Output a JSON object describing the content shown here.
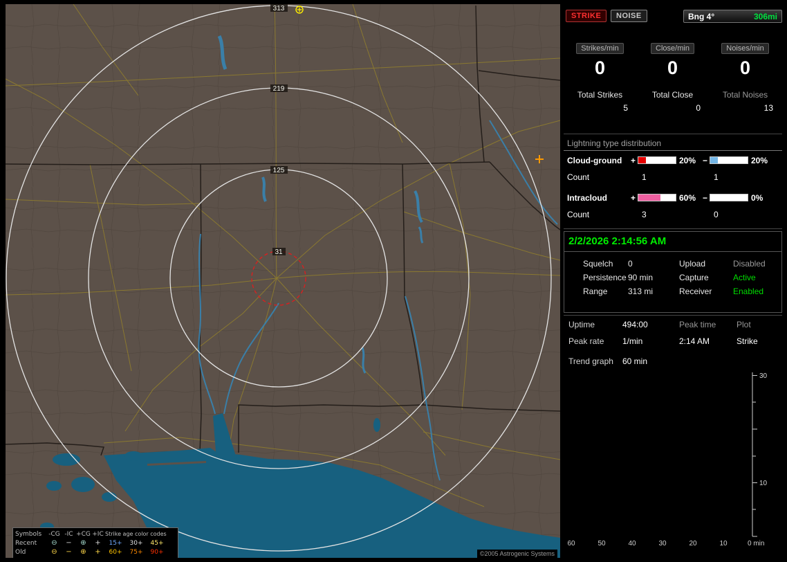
{
  "topbar": {
    "strike_button": "STRIKE",
    "noise_button": "NOISE",
    "bearing": "Bng 4°",
    "distance": "306mi"
  },
  "rates": [
    {
      "label": "Strikes/min",
      "value": "0"
    },
    {
      "label": "Close/min",
      "value": "0"
    },
    {
      "label": "Noises/min",
      "value": "0"
    }
  ],
  "totals": [
    {
      "label": "Total Strikes",
      "value": "5",
      "color": "#e8e8e8"
    },
    {
      "label": "Total Close",
      "value": "0",
      "color": "#e8e8e8"
    },
    {
      "label": "Total Noises",
      "value": "13",
      "color": "#9a9a9a"
    }
  ],
  "distribution": {
    "title": "Lightning type distribution",
    "plus_sign": "+",
    "minus_sign": "−",
    "count_label": "Count",
    "rows": [
      {
        "label": "Cloud-ground",
        "pos_fill": 20,
        "pos_color": "#e60000",
        "pos_pct": "20%",
        "neg_fill": 20,
        "neg_color": "#74b6e6",
        "neg_pct": "20%",
        "pos_count": "1",
        "neg_count": "1"
      },
      {
        "label": "Intracloud",
        "pos_fill": 60,
        "pos_color": "#ee5fa0",
        "pos_pct": "60%",
        "neg_fill": 0,
        "neg_color": "#74b6e6",
        "neg_pct": "0%",
        "pos_count": "3",
        "neg_count": "0"
      }
    ]
  },
  "status": {
    "datetime": "2/2/2026 2:14:56 AM",
    "rows": [
      {
        "l1": "Squelch",
        "v1": "0",
        "l2": "Upload",
        "v2": "Disabled",
        "v2_color": "#9a9a9a"
      },
      {
        "l1": "Persistence",
        "v1": "90 min",
        "l2": "Capture",
        "v2": "Active",
        "v2_color": "#00dd00"
      },
      {
        "l1": "Range",
        "v1": "313 mi",
        "l2": "Receiver",
        "v2": "Enabled",
        "v2_color": "#00dd00"
      }
    ]
  },
  "trend": {
    "uptime_label": "Uptime",
    "uptime_value": "494:00",
    "peak_time_label": "Peak time",
    "plot_label": "Plot",
    "peak_rate_label": "Peak rate",
    "peak_rate_value": "1/min",
    "peak_time_value": "2:14 AM",
    "plot_value": "Strike",
    "trend_graph_label": "Trend graph",
    "trend_graph_value": "60 min",
    "y_ticks": [
      "30",
      "10"
    ],
    "x_ticks": [
      "60",
      "50",
      "40",
      "30",
      "20",
      "10",
      "0 min"
    ]
  },
  "map": {
    "rings": [
      {
        "label": "313"
      },
      {
        "label": "219"
      },
      {
        "label": "125"
      },
      {
        "label": "31"
      }
    ],
    "copyright": "©2005 Astrogenic Systems",
    "legend": {
      "symbols_header": "Symbols",
      "age_header": "Strike age color codes",
      "columns": [
        "-CG",
        "-IC",
        "+CG",
        "+IC"
      ],
      "rows": [
        {
          "label": "Recent",
          "symbols": [
            {
              "glyph": "⊖",
              "color": "#a8ddd0"
            },
            {
              "glyph": "−",
              "color": "#d8d8d8"
            },
            {
              "glyph": "⊕",
              "color": "#a8ddd0"
            },
            {
              "glyph": "+",
              "color": "#d8d8d8"
            }
          ],
          "ages": [
            {
              "text": "15+",
              "color": "#6fa8ff"
            },
            {
              "text": "30+",
              "color": "#e0e0e0"
            },
            {
              "text": "45+",
              "color": "#ffe96a"
            }
          ]
        },
        {
          "label": "Old",
          "symbols": [
            {
              "glyph": "⊖",
              "color": "#ffd84a"
            },
            {
              "glyph": "−",
              "color": "#ffd84a"
            },
            {
              "glyph": "⊕",
              "color": "#ffd84a"
            },
            {
              "glyph": "+",
              "color": "#ffd84a"
            }
          ],
          "ages": [
            {
              "text": "60+",
              "color": "#ffc400"
            },
            {
              "text": "75+",
              "color": "#ff8a00"
            },
            {
              "text": "90+",
              "color": "#ff3000"
            }
          ]
        }
      ]
    }
  }
}
